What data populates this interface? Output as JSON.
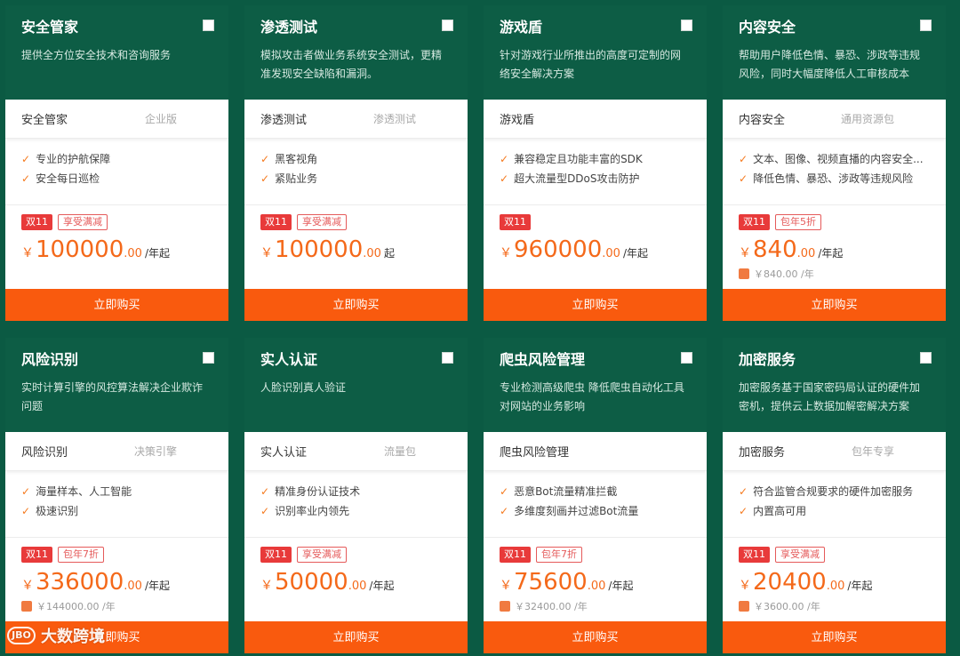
{
  "watermark": {
    "logo": "JBO",
    "text": "大数跨境"
  },
  "cards": [
    {
      "title": "安全管家",
      "desc": "提供全方位安全技术和咨询服务",
      "spec_name": "安全管家",
      "spec_tag": "企业版",
      "features": [
        "专业的护航保障",
        "安全每日巡检"
      ],
      "badge_main": "双11",
      "badge_promo": "享受满减",
      "price_int": "100000",
      "price_dec": ".00",
      "price_unit": "/年起",
      "orig_price": "",
      "buy_label": "立即购买"
    },
    {
      "title": "渗透测试",
      "desc": "模拟攻击者做业务系统安全测试，更精准发现安全缺陷和漏洞。",
      "spec_name": "渗透测试",
      "spec_tag": "渗透测试",
      "features": [
        "黑客视角",
        "紧贴业务"
      ],
      "badge_main": "双11",
      "badge_promo": "享受满减",
      "price_int": "100000",
      "price_dec": ".00",
      "price_unit": "起",
      "orig_price": "",
      "buy_label": "立即购买"
    },
    {
      "title": "游戏盾",
      "desc": "针对游戏行业所推出的高度可定制的网络安全解决方案",
      "spec_name": "游戏盾",
      "spec_tag": "",
      "features": [
        "兼容稳定且功能丰富的SDK",
        "超大流量型DDoS攻击防护"
      ],
      "badge_main": "双11",
      "badge_promo": "",
      "price_int": "960000",
      "price_dec": ".00",
      "price_unit": "/年起",
      "orig_price": "",
      "buy_label": "立即购买"
    },
    {
      "title": "内容安全",
      "desc": "帮助用户降低色情、暴恐、涉政等违规风险，同时大幅度降低人工审核成本",
      "spec_name": "内容安全",
      "spec_tag": "通用资源包",
      "features": [
        "文本、图像、视频直播的内容安全...",
        "降低色情、暴恐、涉政等违规风险"
      ],
      "badge_main": "双11",
      "badge_promo": "包年5折",
      "price_int": "840",
      "price_dec": ".00",
      "price_unit": "/年起",
      "orig_price": "￥840.00 /年",
      "buy_label": "立即购买"
    },
    {
      "title": "风险识别",
      "desc": "实时计算引擎的风控算法解决企业欺诈问题",
      "spec_name": "风险识别",
      "spec_tag": "决策引擎",
      "features": [
        "海量样本、人工智能",
        "极速识别"
      ],
      "badge_main": "双11",
      "badge_promo": "包年7折",
      "price_int": "336000",
      "price_dec": ".00",
      "price_unit": "/年起",
      "orig_price": "￥144000.00 /年",
      "buy_label": "立即购买"
    },
    {
      "title": "实人认证",
      "desc": "人脸识别真人验证",
      "spec_name": "实人认证",
      "spec_tag": "流量包",
      "features": [
        "精准身份认证技术",
        "识别率业内领先"
      ],
      "badge_main": "双11",
      "badge_promo": "享受满减",
      "price_int": "50000",
      "price_dec": ".00",
      "price_unit": "/年起",
      "orig_price": "",
      "buy_label": "立即购买"
    },
    {
      "title": "爬虫风险管理",
      "desc": "专业检测高级爬虫 降低爬虫自动化工具对网站的业务影响",
      "spec_name": "爬虫风险管理",
      "spec_tag": "",
      "features": [
        "恶意Bot流量精准拦截",
        "多维度刻画并过滤Bot流量"
      ],
      "badge_main": "双11",
      "badge_promo": "包年7折",
      "price_int": "75600",
      "price_dec": ".00",
      "price_unit": "/年起",
      "orig_price": "￥32400.00 /年",
      "buy_label": "立即购买"
    },
    {
      "title": "加密服务",
      "desc": "加密服务基于国家密码局认证的硬件加密机，提供云上数据加解密解决方案",
      "spec_name": "加密服务",
      "spec_tag": "包年专享",
      "features": [
        "符合监管合规要求的硬件加密服务",
        "内置高可用"
      ],
      "badge_main": "双11",
      "badge_promo": "享受满减",
      "price_int": "20400",
      "price_dec": ".00",
      "price_unit": "/年起",
      "orig_price": "￥3600.00 /年",
      "buy_label": "立即购买"
    }
  ]
}
